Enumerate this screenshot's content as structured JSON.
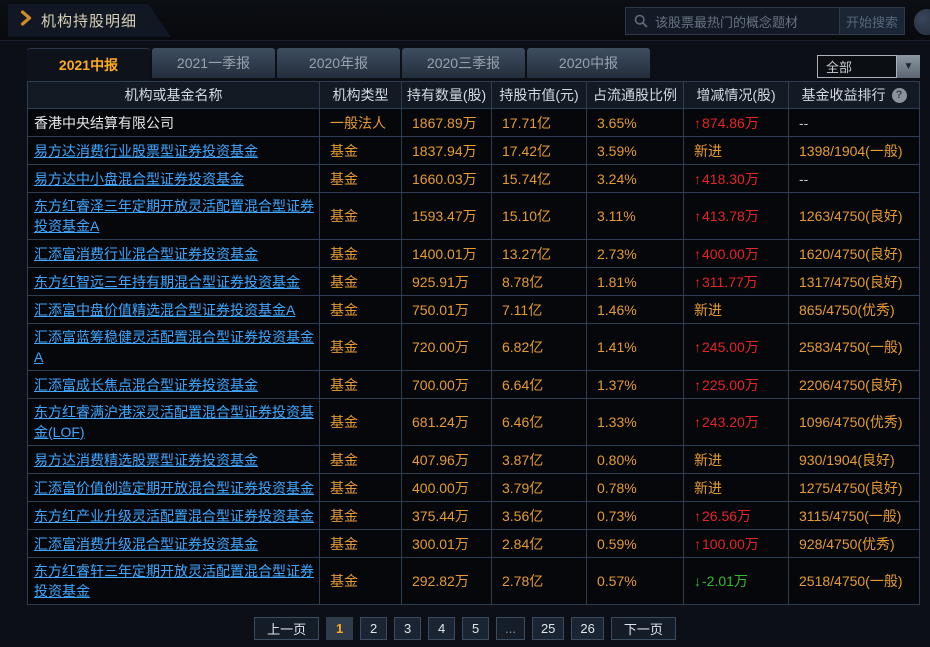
{
  "header": {
    "title": "机构持股明细",
    "search_placeholder": "该股票最热门的概念题材",
    "search_button": "开始搜索"
  },
  "tabs": [
    {
      "label": "2021中报",
      "active": true
    },
    {
      "label": "2021一季报",
      "active": false
    },
    {
      "label": "2020年报",
      "active": false
    },
    {
      "label": "2020三季报",
      "active": false
    },
    {
      "label": "2020中报",
      "active": false
    }
  ],
  "filter": {
    "selected": "全部",
    "arrow_icon": "▼"
  },
  "table": {
    "columns": [
      "机构或基金名称",
      "机构类型",
      "持有数量(股)",
      "持股市值(元)",
      "占流通股比例",
      "增减情况(股)",
      "基金收益排行"
    ],
    "help_icon": "?",
    "rows": [
      {
        "name": "香港中央结算有限公司",
        "link": false,
        "type": "一般法人",
        "qty": "1867.89万",
        "mval": "17.71亿",
        "ratio": "3.65%",
        "change_dir": "up",
        "change": "874.86万",
        "rank": "--"
      },
      {
        "name": "易方达消费行业股票型证券投资基金",
        "link": true,
        "type": "基金",
        "qty": "1837.94万",
        "mval": "17.42亿",
        "ratio": "3.59%",
        "change_dir": "new",
        "change": "新进",
        "rank": "1398/1904(一般)"
      },
      {
        "name": "易方达中小盘混合型证券投资基金",
        "link": true,
        "type": "基金",
        "qty": "1660.03万",
        "mval": "15.74亿",
        "ratio": "3.24%",
        "change_dir": "up",
        "change": "418.30万",
        "rank": "--"
      },
      {
        "name": "东方红睿泽三年定期开放灵活配置混合型证券投资基金A",
        "link": true,
        "type": "基金",
        "qty": "1593.47万",
        "mval": "15.10亿",
        "ratio": "3.11%",
        "change_dir": "up",
        "change": "413.78万",
        "rank": "1263/4750(良好)"
      },
      {
        "name": "汇添富消费行业混合型证券投资基金",
        "link": true,
        "type": "基金",
        "qty": "1400.01万",
        "mval": "13.27亿",
        "ratio": "2.73%",
        "change_dir": "up",
        "change": "400.00万",
        "rank": "1620/4750(良好)"
      },
      {
        "name": "东方红智远三年持有期混合型证券投资基金",
        "link": true,
        "type": "基金",
        "qty": "925.91万",
        "mval": "8.78亿",
        "ratio": "1.81%",
        "change_dir": "up",
        "change": "311.77万",
        "rank": "1317/4750(良好)"
      },
      {
        "name": "汇添富中盘价值精选混合型证券投资基金A",
        "link": true,
        "type": "基金",
        "qty": "750.01万",
        "mval": "7.11亿",
        "ratio": "1.46%",
        "change_dir": "new",
        "change": "新进",
        "rank": "865/4750(优秀)"
      },
      {
        "name": "汇添富蓝筹稳健灵活配置混合型证券投资基金A",
        "link": true,
        "type": "基金",
        "qty": "720.00万",
        "mval": "6.82亿",
        "ratio": "1.41%",
        "change_dir": "up",
        "change": "245.00万",
        "rank": "2583/4750(一般)"
      },
      {
        "name": "汇添富成长焦点混合型证券投资基金",
        "link": true,
        "type": "基金",
        "qty": "700.00万",
        "mval": "6.64亿",
        "ratio": "1.37%",
        "change_dir": "up",
        "change": "225.00万",
        "rank": "2206/4750(良好)"
      },
      {
        "name": "东方红睿满沪港深灵活配置混合型证券投资基金(LOF)",
        "link": true,
        "type": "基金",
        "qty": "681.24万",
        "mval": "6.46亿",
        "ratio": "1.33%",
        "change_dir": "up",
        "change": "243.20万",
        "rank": "1096/4750(优秀)"
      },
      {
        "name": "易方达消费精选股票型证券投资基金",
        "link": true,
        "type": "基金",
        "qty": "407.96万",
        "mval": "3.87亿",
        "ratio": "0.80%",
        "change_dir": "new",
        "change": "新进",
        "rank": "930/1904(良好)"
      },
      {
        "name": "汇添富价值创造定期开放混合型证券投资基金",
        "link": true,
        "type": "基金",
        "qty": "400.00万",
        "mval": "3.79亿",
        "ratio": "0.78%",
        "change_dir": "new",
        "change": "新进",
        "rank": "1275/4750(良好)"
      },
      {
        "name": "东方红产业升级灵活配置混合型证券投资基金",
        "link": true,
        "type": "基金",
        "qty": "375.44万",
        "mval": "3.56亿",
        "ratio": "0.73%",
        "change_dir": "up",
        "change": "26.56万",
        "rank": "3115/4750(一般)"
      },
      {
        "name": "汇添富消费升级混合型证券投资基金",
        "link": true,
        "type": "基金",
        "qty": "300.01万",
        "mval": "2.84亿",
        "ratio": "0.59%",
        "change_dir": "up",
        "change": "100.00万",
        "rank": "928/4750(优秀)"
      },
      {
        "name": "东方红睿轩三年定期开放灵活配置混合型证券投资基金",
        "link": true,
        "type": "基金",
        "qty": "292.82万",
        "mval": "2.78亿",
        "ratio": "0.57%",
        "change_dir": "down",
        "change": "-2.01万",
        "rank": "2518/4750(一般)"
      }
    ]
  },
  "pagination": {
    "prev": "上一页",
    "next": "下一页",
    "pages": [
      "1",
      "2",
      "3",
      "4",
      "5",
      "...",
      "25",
      "26"
    ],
    "current": "1"
  },
  "colors": {
    "accent_orange": "#ffa91e",
    "value_orange": "#e69b33",
    "link_blue": "#3fa7ff",
    "up_red": "#e42525",
    "down_green": "#33bb33",
    "table_border": "#2e3e52"
  }
}
